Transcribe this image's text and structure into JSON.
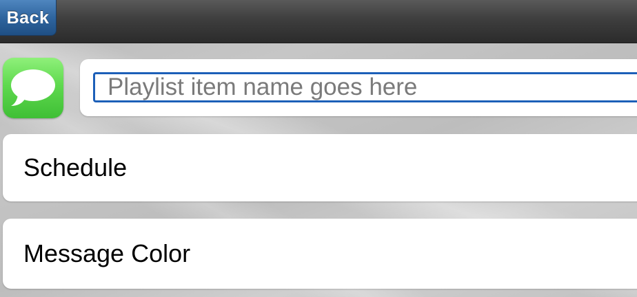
{
  "nav": {
    "back_label": "Back"
  },
  "item": {
    "icon": "messages-icon",
    "name_placeholder": "Playlist item name goes here",
    "name_value": ""
  },
  "rows": [
    {
      "label": "Schedule"
    },
    {
      "label": "Message Color"
    }
  ],
  "colors": {
    "nav_bar": "#3e3e3e",
    "back_button": "#2f659f",
    "input_border": "#1c5fb8",
    "icon_green": "#5fd94f"
  }
}
